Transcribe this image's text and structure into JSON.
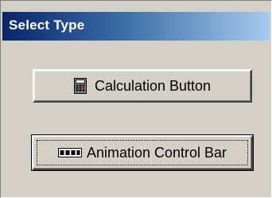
{
  "dialog": {
    "title": "Select Type"
  },
  "buttons": {
    "calculation": {
      "label": "Calculation Button",
      "icon": "calculator-icon"
    },
    "animation": {
      "label": "Animation Control Bar",
      "icon": "control-bar-icon"
    }
  },
  "colors": {
    "face": "#d4d0c8",
    "title_start": "#0a246a",
    "title_end": "#a6caf0"
  }
}
